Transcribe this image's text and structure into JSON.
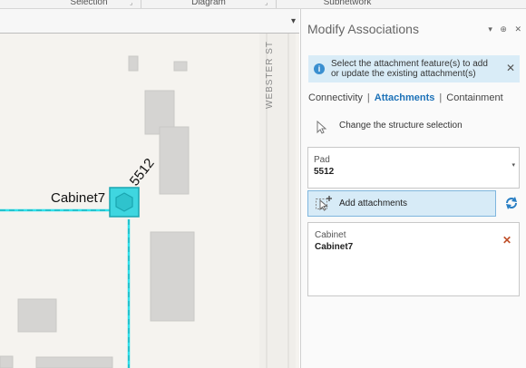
{
  "ribbon": {
    "groups": [
      "Selection",
      "Diagram",
      "Subnetwork"
    ]
  },
  "map": {
    "dropdown_icon": "chevron-down-icon",
    "road_label": "WEBSTER ST",
    "cabinet_label": "Cabinet7",
    "pad_label": "5512",
    "colors": {
      "line": "#2fe0ea",
      "node_fill": "#3fd6e0",
      "node_stroke": "#1aa5b0",
      "building": "#d5d4d2"
    }
  },
  "pane": {
    "title": "Modify Associations",
    "tools": {
      "menu_icon": "dropdown-icon",
      "pin_icon": "pin-icon",
      "close_icon": "close-icon"
    },
    "info": {
      "icon": "info-icon",
      "text": "Select the attachment feature(s) to add or update the existing attachment(s)",
      "close_icon": "close-icon"
    },
    "tabs": [
      {
        "label": "Connectivity",
        "active": false
      },
      {
        "label": "Attachments",
        "active": true
      },
      {
        "label": "Containment",
        "active": false
      }
    ],
    "change_structure": {
      "icon": "cursor-arrow-icon",
      "label": "Change the structure selection"
    },
    "structure": {
      "type": "Pad",
      "id": "5512"
    },
    "add_attachments": {
      "icon": "select-add-icon",
      "label": "Add attachments",
      "refresh_icon": "refresh-icon"
    },
    "attachments": [
      {
        "type": "Cabinet",
        "name": "Cabinet7",
        "remove_icon": "remove-x-icon"
      }
    ],
    "accent": "#1d72b8"
  }
}
